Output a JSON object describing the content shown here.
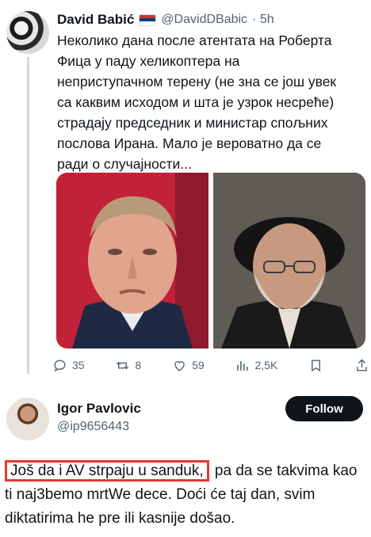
{
  "tweet": {
    "name": "David Babić",
    "handle": "@DavidDBabic",
    "time": "· 5h",
    "text": "Неколико дана после атентата на Роберта\nФица у паду хеликоптера на\nнеприступачном терену (не зна се још увек\nса каквим исходом и шта је узрок несреће)\nстрадају председник и министар спољних\nпослова Ирана. Мало је вероватно да се\nради о случајности...",
    "flag_colors": [
      "#c6363c",
      "#0c4076",
      "#ffffff"
    ],
    "stats": {
      "replies": "35",
      "reposts": "8",
      "likes": "59",
      "views": "2,5K"
    }
  },
  "reply": {
    "name": "Igor Pavlovic",
    "handle": "@ip9656443",
    "follow_label": "Follow",
    "text_highlighted": "Još da i AV strpaju u sanduk,",
    "text_rest": " pa da se takvima kao ti naj3bemo mrtWe dece. Doći će taj dan, svim diktatirima he pre ili kasnije došao.",
    "highlight_color": "#e53935"
  },
  "icons": [
    "reply-icon",
    "repost-icon",
    "like-icon",
    "views-icon",
    "bookmark-icon",
    "share-icon"
  ]
}
